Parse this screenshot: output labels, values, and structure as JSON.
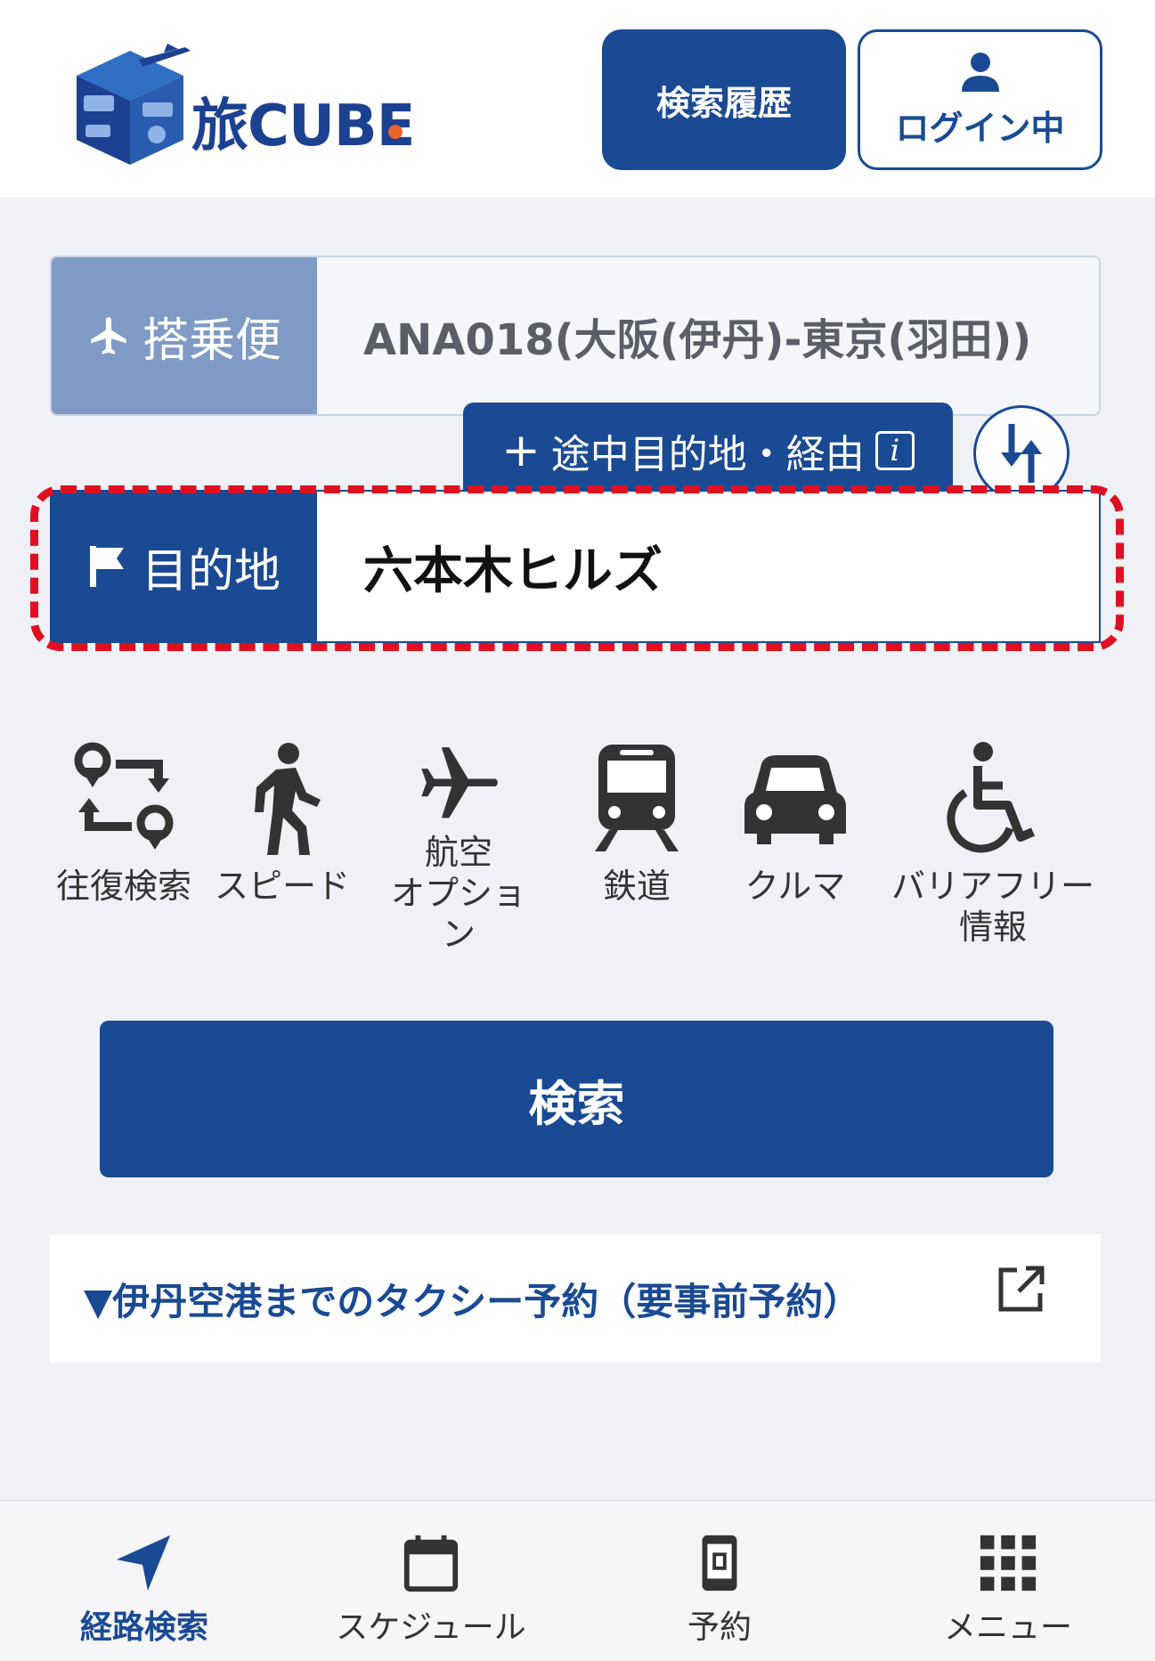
{
  "header": {
    "logo_text": "旅CUBE",
    "history_button": "検索履歴",
    "login_button": "ログイン中"
  },
  "form": {
    "flight_label": "搭乗便",
    "flight_value": "ANA018(大阪(伊丹)-東京(羽田))",
    "via_button": "途中目的地・経由",
    "info_icon": "i",
    "destination_label": "目的地",
    "destination_value": "六本木ヒルズ"
  },
  "options": [
    {
      "icon": "round-trip-icon",
      "label": "往復検索"
    },
    {
      "icon": "walking-person-icon",
      "label": "スピード"
    },
    {
      "icon": "airplane-icon",
      "label": "航空\nオプション"
    },
    {
      "icon": "train-icon",
      "label": "鉄道"
    },
    {
      "icon": "car-icon",
      "label": "クルマ"
    },
    {
      "icon": "wheelchair-icon",
      "label": "バリアフリー\n情報"
    }
  ],
  "search_button": "検索",
  "taxi_link": "▼伊丹空港までのタクシー予約（要事前予約）",
  "bottom_nav": [
    {
      "icon": "navigation-arrow-icon",
      "label": "経路検索",
      "active": true
    },
    {
      "icon": "calendar-icon",
      "label": "スケジュール",
      "active": false
    },
    {
      "icon": "ticket-phone-icon",
      "label": "予約",
      "active": false
    },
    {
      "icon": "grid-menu-icon",
      "label": "メニュー",
      "active": false
    }
  ],
  "colors": {
    "brand_navy": "#1a4a93",
    "flight_label_bg": "#7f9ac4",
    "highlight_red": "#e01020",
    "content_bg": "#eff1f6"
  }
}
